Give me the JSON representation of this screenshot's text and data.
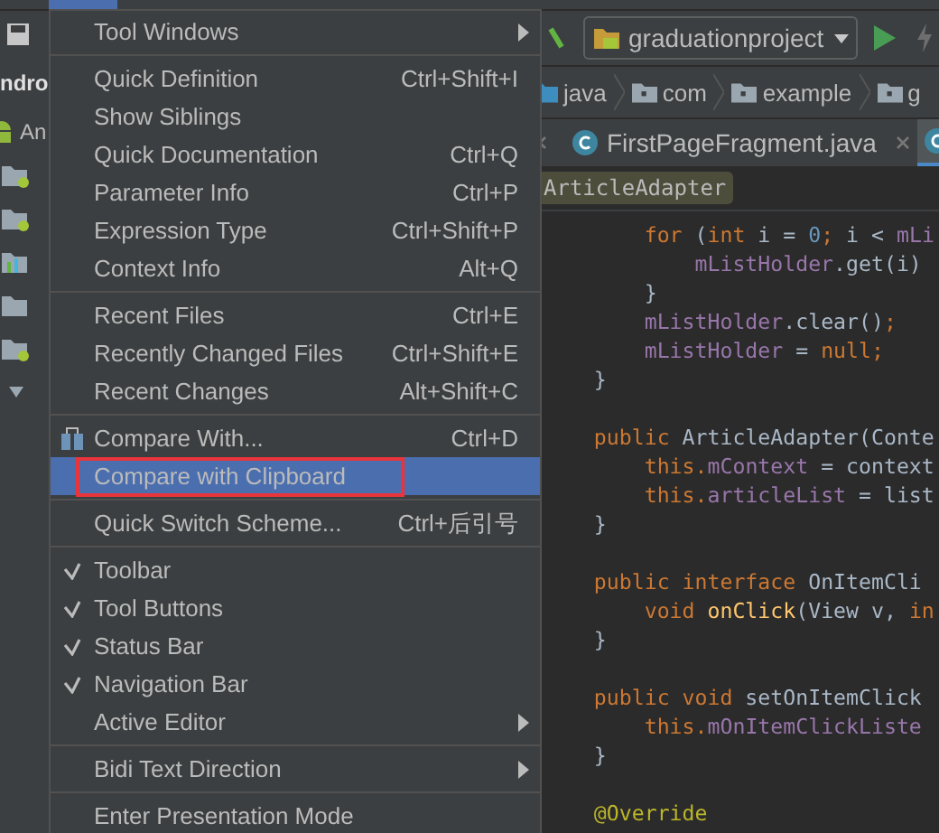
{
  "project_panel": {
    "title": "ndro",
    "view_label": "An"
  },
  "toolbar": {
    "run_config": "graduationproject"
  },
  "breadcrumbs": [
    "java",
    "com",
    "example",
    "g"
  ],
  "tabs": [
    {
      "label": "FirstPageFragment.java",
      "selected": false
    },
    {
      "selected": true
    }
  ],
  "class_tag": "ArticleAdapter",
  "code_blocks": [
    {
      "lines": [
        {
          "tokens": [
            {
              "t": "        for",
              "kind": "keyword"
            },
            {
              "t": " (",
              "kind": "plain"
            },
            {
              "t": "int",
              "kind": "keyword"
            },
            {
              "t": " i = ",
              "kind": "plain"
            },
            {
              "t": "0",
              "kind": "number"
            },
            {
              "t": ";",
              "kind": "keyword"
            },
            {
              "t": " i < ",
              "kind": "plain"
            },
            {
              "t": "mLi",
              "kind": "field"
            }
          ]
        },
        {
          "tokens": [
            {
              "t": "            mListHolder",
              "kind": "field"
            },
            {
              "t": ".get(i)",
              "kind": "plain"
            }
          ]
        },
        {
          "tokens": [
            {
              "t": "        }",
              "kind": "plain"
            }
          ]
        },
        {
          "tokens": [
            {
              "t": "        mListHolder",
              "kind": "field"
            },
            {
              "t": ".clear()",
              "kind": "plain"
            },
            {
              "t": ";",
              "kind": "keyword"
            }
          ]
        },
        {
          "tokens": [
            {
              "t": "        mListHolder",
              "kind": "field"
            },
            {
              "t": " = ",
              "kind": "plain"
            },
            {
              "t": "null;",
              "kind": "keyword"
            }
          ]
        },
        {
          "tokens": [
            {
              "t": "    }",
              "kind": "plain"
            }
          ]
        }
      ]
    },
    {
      "lines": [
        {
          "tokens": [
            {
              "t": "    public",
              "kind": "keyword"
            },
            {
              "t": " ArticleAdapter(Conte",
              "kind": "plain"
            }
          ]
        },
        {
          "tokens": [
            {
              "t": "        this.",
              "kind": "keyword"
            },
            {
              "t": "mContext",
              "kind": "field"
            },
            {
              "t": " = context",
              "kind": "plain"
            }
          ]
        },
        {
          "tokens": [
            {
              "t": "        this.",
              "kind": "keyword"
            },
            {
              "t": "articleList",
              "kind": "field"
            },
            {
              "t": " = list",
              "kind": "plain"
            }
          ]
        },
        {
          "tokens": [
            {
              "t": "    }",
              "kind": "plain"
            }
          ]
        }
      ]
    },
    {
      "lines": [
        {
          "tokens": [
            {
              "t": "    public interface",
              "kind": "keyword"
            },
            {
              "t": " OnItemCli",
              "kind": "plain"
            }
          ]
        },
        {
          "tokens": [
            {
              "t": "        void",
              "kind": "keyword"
            },
            {
              "t": " onClick",
              "kind": "method"
            },
            {
              "t": "(View v, ",
              "kind": "plain"
            },
            {
              "t": "in",
              "kind": "keyword"
            }
          ]
        },
        {
          "tokens": [
            {
              "t": "    }",
              "kind": "plain"
            }
          ]
        }
      ]
    },
    {
      "lines": [
        {
          "tokens": [
            {
              "t": "    public void",
              "kind": "keyword"
            },
            {
              "t": " setOnItemClick",
              "kind": "plain"
            }
          ]
        },
        {
          "tokens": [
            {
              "t": "        this.",
              "kind": "keyword"
            },
            {
              "t": "mOnItemClickListe",
              "kind": "field"
            }
          ]
        },
        {
          "tokens": [
            {
              "t": "    }",
              "kind": "plain"
            }
          ]
        }
      ]
    },
    {
      "lines": [
        {
          "tokens": [
            {
              "t": "    @Override",
              "kind": "annotation"
            }
          ]
        }
      ]
    }
  ],
  "menu": [
    {
      "kind": "item",
      "label": "Tool Windows",
      "submenu": true,
      "checked": false,
      "selected": false
    },
    {
      "kind": "separator"
    },
    {
      "kind": "item",
      "label": "Quick Definition",
      "shortcut": "Ctrl+Shift+I",
      "checked": false,
      "selected": false
    },
    {
      "kind": "item",
      "label": "Show Siblings",
      "checked": false,
      "selected": false
    },
    {
      "kind": "item",
      "label": "Quick Documentation",
      "shortcut": "Ctrl+Q",
      "checked": false,
      "selected": false
    },
    {
      "kind": "item",
      "label": "Parameter Info",
      "shortcut": "Ctrl+P",
      "checked": false,
      "selected": false
    },
    {
      "kind": "item",
      "label": "Expression Type",
      "shortcut": "Ctrl+Shift+P",
      "checked": false,
      "selected": false
    },
    {
      "kind": "item",
      "label": "Context Info",
      "shortcut": "Alt+Q",
      "checked": false,
      "selected": false
    },
    {
      "kind": "separator"
    },
    {
      "kind": "item",
      "label": "Recent Files",
      "shortcut": "Ctrl+E",
      "checked": false,
      "selected": false
    },
    {
      "kind": "item",
      "label": "Recently Changed Files",
      "shortcut": "Ctrl+Shift+E",
      "checked": false,
      "selected": false
    },
    {
      "kind": "item",
      "label": "Recent Changes",
      "shortcut": "Alt+Shift+C",
      "checked": false,
      "selected": false
    },
    {
      "kind": "separator"
    },
    {
      "kind": "item",
      "label": "Compare With...",
      "shortcut": "Ctrl+D",
      "icon": true,
      "checked": false,
      "selected": false
    },
    {
      "kind": "item",
      "label": "Compare with Clipboard",
      "checked": false,
      "selected": true,
      "marked": true
    },
    {
      "kind": "separator"
    },
    {
      "kind": "item",
      "label": "Quick Switch Scheme...",
      "shortcut": "Ctrl+后引号",
      "checked": false,
      "selected": false
    },
    {
      "kind": "separator"
    },
    {
      "kind": "item",
      "label": "Toolbar",
      "checked": true,
      "selected": false
    },
    {
      "kind": "item",
      "label": "Tool Buttons",
      "checked": true,
      "selected": false
    },
    {
      "kind": "item",
      "label": "Status Bar",
      "checked": true,
      "selected": false
    },
    {
      "kind": "item",
      "label": "Navigation Bar",
      "checked": true,
      "selected": false
    },
    {
      "kind": "item",
      "label": "Active Editor",
      "submenu": true,
      "checked": false,
      "selected": false
    },
    {
      "kind": "separator"
    },
    {
      "kind": "item",
      "label": "Bidi Text Direction",
      "submenu": true,
      "checked": false,
      "selected": false
    },
    {
      "kind": "separator"
    },
    {
      "kind": "item",
      "label": "Enter Presentation Mode",
      "checked": false,
      "selected": false
    }
  ]
}
